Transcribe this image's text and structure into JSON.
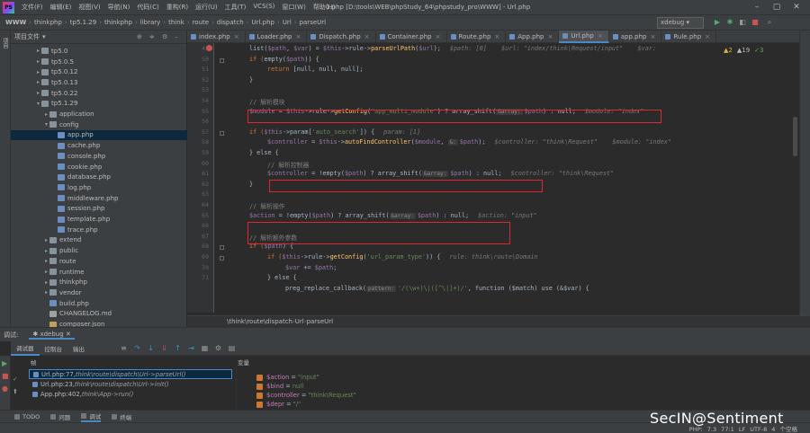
{
  "titlebar": {
    "menu": [
      "文件(F)",
      "编辑(E)",
      "视图(V)",
      "导航(N)",
      "代码(C)",
      "重构(R)",
      "运行(U)",
      "工具(T)",
      "VCS(S)",
      "窗口(W)",
      "帮助(H)"
    ],
    "title": "1.php [D:\\tools\\WEB\\phpStudy_64\\phpstudy_pro\\WWW] - Url.php"
  },
  "navbar": {
    "crumbs": [
      "WWW",
      "thinkphp",
      "tp5.1.29",
      "thinkphp",
      "library",
      "think",
      "route",
      "dispatch",
      "Url.php",
      "Url",
      "parseUrl"
    ],
    "run_config": "xdebug"
  },
  "project": {
    "header": "项目文件",
    "left_strip_label": "项目",
    "rows": [
      {
        "label": "tp5.0",
        "type": "folder",
        "arrow": "▸",
        "indent": 3
      },
      {
        "label": "tp5.0.5",
        "type": "folder",
        "arrow": "▸",
        "indent": 3
      },
      {
        "label": "tp5.0.12",
        "type": "folder",
        "arrow": "▸",
        "indent": 3
      },
      {
        "label": "tp5.0.13",
        "type": "folder",
        "arrow": "▸",
        "indent": 3
      },
      {
        "label": "tp5.0.22",
        "type": "folder",
        "arrow": "▸",
        "indent": 3
      },
      {
        "label": "tp5.1.29",
        "type": "folder",
        "arrow": "▾",
        "indent": 3
      },
      {
        "label": "application",
        "type": "folder",
        "arrow": "▸",
        "indent": 4
      },
      {
        "label": "config",
        "type": "folder",
        "arrow": "▾",
        "indent": 4
      },
      {
        "label": "app.php",
        "type": "php",
        "arrow": "",
        "indent": 5,
        "selected": true
      },
      {
        "label": "cache.php",
        "type": "php",
        "arrow": "",
        "indent": 5
      },
      {
        "label": "console.php",
        "type": "php",
        "arrow": "",
        "indent": 5
      },
      {
        "label": "cookie.php",
        "type": "php",
        "arrow": "",
        "indent": 5
      },
      {
        "label": "database.php",
        "type": "php",
        "arrow": "",
        "indent": 5
      },
      {
        "label": "log.php",
        "type": "php",
        "arrow": "",
        "indent": 5
      },
      {
        "label": "middleware.php",
        "type": "php",
        "arrow": "",
        "indent": 5
      },
      {
        "label": "session.php",
        "type": "php",
        "arrow": "",
        "indent": 5
      },
      {
        "label": "template.php",
        "type": "php",
        "arrow": "",
        "indent": 5
      },
      {
        "label": "trace.php",
        "type": "php",
        "arrow": "",
        "indent": 5
      },
      {
        "label": "extend",
        "type": "folder",
        "arrow": "▸",
        "indent": 4
      },
      {
        "label": "public",
        "type": "folder",
        "arrow": "▸",
        "indent": 4
      },
      {
        "label": "route",
        "type": "folder",
        "arrow": "▸",
        "indent": 4
      },
      {
        "label": "runtime",
        "type": "folder",
        "arrow": "▸",
        "indent": 4
      },
      {
        "label": "thinkphp",
        "type": "folder",
        "arrow": "▸",
        "indent": 4
      },
      {
        "label": "vendor",
        "type": "folder",
        "arrow": "▸",
        "indent": 4
      },
      {
        "label": "build.php",
        "type": "php",
        "arrow": "",
        "indent": 4
      },
      {
        "label": "CHANGELOG.md",
        "type": "md",
        "arrow": "",
        "indent": 4
      },
      {
        "label": "composer.json",
        "type": "json",
        "arrow": "",
        "indent": 4
      }
    ]
  },
  "tabs": [
    "index.php",
    "Loader.php",
    "Dispatch.php",
    "Container.php",
    "Route.php",
    "App.php",
    "Url.php",
    "app.php",
    "Rule.php"
  ],
  "active_tab_index": 6,
  "editor": {
    "line_numbers": [
      "49",
      "50",
      "51",
      "52",
      "53",
      "54",
      "55",
      "56",
      "57",
      "58",
      "59",
      "60",
      "61",
      "62",
      "63",
      "64",
      "65",
      "66",
      "67",
      "68",
      "69",
      "70",
      "71"
    ],
    "inspections": {
      "warnings": "2",
      "weak": "19",
      "typos": "3"
    },
    "breadcrumb": [
      "\\think\\route\\dispatch",
      "Url",
      "parseUrl"
    ]
  },
  "code": {
    "l1": {
      "a": "list(",
      "b": "$path",
      "c": ", ",
      "d": "$var",
      "e": ") = ",
      "f": "$this",
      "g": "->rule->",
      "h": "parseUrlPath",
      "i": "(",
      "j": "$url",
      "k": ");",
      "hint": "$path: [0]    $url: \"index/think\\Request/input\"    $var:"
    },
    "l2": {
      "a": "if (",
      "b": "empty",
      "c": "(",
      "d": "$path",
      "e": ")) {"
    },
    "l3": {
      "a": "return ",
      "b": "[null, null, null];"
    },
    "l4": {
      "a": "}"
    },
    "l6": {
      "cm": "// 解析模块"
    },
    "l7": {
      "a": "$module",
      "b": " = ",
      "c": "$this",
      "d": "->rule->",
      "e": "getConfig",
      "f": "(",
      "g": "'app_multi_module'",
      "h": ") ? ",
      "i": "array_shift",
      "j": "(",
      "inlay": "&array:",
      "k": "$path",
      "l": ") : null;",
      "hint": "$module: \"index\""
    },
    "l9": {
      "a": "if (",
      "b": "$this",
      "c": "->",
      "d": "param",
      "e": "[",
      "f": "'auto_search'",
      "g": "]) {",
      "hint": "param: [1]"
    },
    "l10": {
      "a": "$controller",
      "b": " = ",
      "c": "$this",
      "d": "->",
      "e": "autoFindController",
      "f": "(",
      "g": "$module",
      "h": ", ",
      "inlay": "&:",
      "i": "$path",
      "j": ");",
      "hint": "$controller: \"think\\Request\"    $module: \"index\""
    },
    "l11": {
      "a": "} else {"
    },
    "l12": {
      "cm": "// 解析控制器"
    },
    "l13": {
      "a": "$controller",
      "b": " = !",
      "c": "empty",
      "d": "(",
      "e": "$path",
      "f": ") ? ",
      "g": "array_shift",
      "h": "(",
      "inlay": "&array:",
      "i": "$path",
      "j": ") : null;",
      "hint": "$controller: \"think\\Request\""
    },
    "l14": {
      "a": "}"
    },
    "l16": {
      "cm": "// 解析操作"
    },
    "l17": {
      "a": "$action",
      "b": " = !",
      "c": "empty",
      "d": "(",
      "e": "$path",
      "f": ") ? ",
      "g": "array_shift",
      "h": "(",
      "inlay": "&array:",
      "i": "$path",
      "j": ") : null;",
      "hint": "$action: \"input\""
    },
    "l19": {
      "cm": "// 解析额外参数"
    },
    "l20": {
      "a": "if (",
      "b": "$path",
      "c": ") {"
    },
    "l21": {
      "a": "if (",
      "b": "$this",
      "c": "->rule->",
      "d": "getConfig",
      "e": "(",
      "f": "'url_param_type'",
      "g": ")) {",
      "hint": "rule: think\\route\\Domain"
    },
    "l22": {
      "a": "$var",
      "b": " += ",
      "c": "$path",
      "d": ";"
    },
    "l23": {
      "a": "} else {"
    },
    "l24": {
      "a": "preg_replace_callback(",
      "inlay": "pattern:",
      "b": "'/(\\w+)\\|([^\\|]+)/'",
      "c": ", function ($match) use (&$var) {"
    }
  },
  "debug": {
    "title": "调试:",
    "session": "xdebug",
    "tabs": [
      "调试器",
      "控制台",
      "输出"
    ],
    "frames_header": "帧",
    "frames": [
      {
        "loc": "Url.php:77, ",
        "cls": "think\\route\\dispatch\\Url->parseUrl()",
        "selected": true
      },
      {
        "loc": "Url.php:23, ",
        "cls": "think\\route\\dispatch\\Url->init()"
      },
      {
        "loc": "App.php:402, ",
        "cls": "think\\App->run()"
      }
    ],
    "vars_header": "变量",
    "vars": [
      {
        "name": "$action",
        "value": "\"input\""
      },
      {
        "name": "$bind",
        "value": "null"
      },
      {
        "name": "$controller",
        "value": "\"think\\Request\""
      },
      {
        "name": "$depr",
        "value": "\"/\""
      }
    ]
  },
  "bottom_tabs": [
    "TODO",
    "问题",
    "调试",
    "终端"
  ],
  "status": {
    "right": "PHP: 7.3   77:1   LF   UTF-8   4 个空格"
  },
  "watermark": "SecIN@Sentiment",
  "colors": {
    "highlight_box": "#e0262e",
    "keyword": "#cc7832",
    "variable": "#9876aa",
    "function": "#ffc66d",
    "string": "#6a8759",
    "selection": "#0d293e"
  }
}
